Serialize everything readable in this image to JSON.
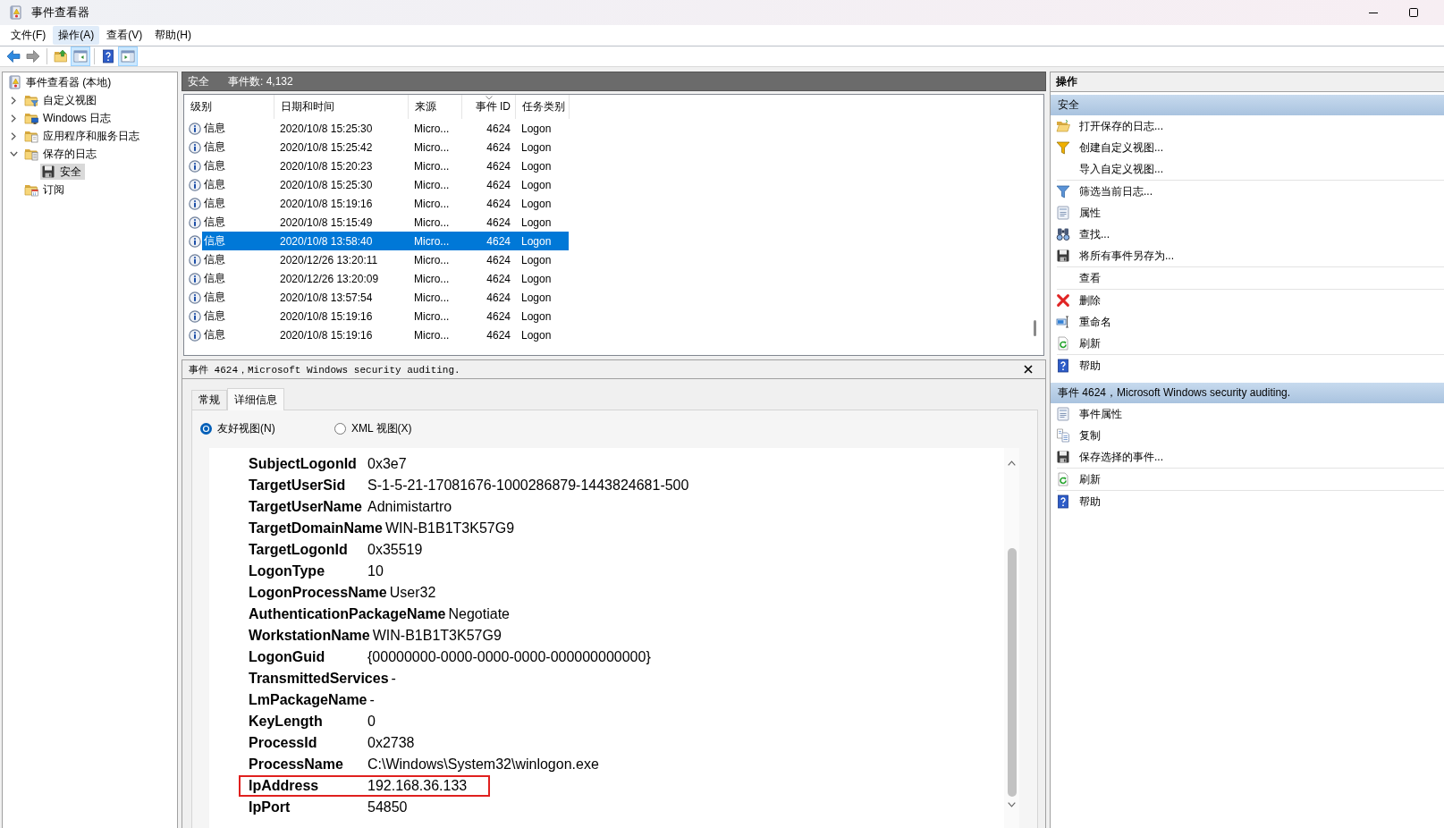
{
  "window": {
    "title": "事件查看器"
  },
  "menu": [
    {
      "label": "文件(F)",
      "highlighted": false
    },
    {
      "label": "操作(A)",
      "highlighted": true
    },
    {
      "label": "查看(V)",
      "highlighted": false
    },
    {
      "label": "帮助(H)",
      "highlighted": false
    }
  ],
  "toolbar": [
    [
      {
        "kind": "back",
        "pressed": false,
        "disabled": false
      },
      {
        "kind": "forward",
        "pressed": false,
        "disabled": true
      }
    ],
    [
      {
        "kind": "up",
        "pressed": false,
        "disabled": false
      },
      {
        "kind": "console-tree",
        "pressed": true,
        "disabled": false
      }
    ],
    [
      {
        "kind": "help",
        "pressed": false,
        "disabled": false
      },
      {
        "kind": "action-pane",
        "pressed": true,
        "disabled": false
      }
    ]
  ],
  "tree": [
    {
      "label": "事件查看器 (本地)",
      "kind": "console",
      "selected": false,
      "children": [
        {
          "label": "自定义视图",
          "kind": "custom-views",
          "expanded": false,
          "selected": false
        },
        {
          "label": "Windows 日志",
          "kind": "windows-logs",
          "expanded": false,
          "selected": false
        },
        {
          "label": "应用程序和服务日志",
          "kind": "app-logs",
          "expanded": false,
          "selected": false
        },
        {
          "label": "保存的日志",
          "kind": "saved-logs",
          "expanded": true,
          "selected": false,
          "children": [
            {
              "label": "安全",
              "kind": "log",
              "selected": true
            }
          ]
        },
        {
          "label": "订阅",
          "kind": "subscriptions",
          "selected": false
        }
      ]
    }
  ],
  "log_header": {
    "name": "安全",
    "count": "事件数: 4,132"
  },
  "events": {
    "columns": [
      {
        "label": "级别",
        "sorted": false
      },
      {
        "label": "日期和时间",
        "sorted": false
      },
      {
        "label": "来源",
        "sorted": false
      },
      {
        "label": "事件 ID",
        "sorted": true
      },
      {
        "label": "任务类别",
        "sorted": false
      }
    ],
    "rows": [
      {
        "level": "信息",
        "date": "2020/10/8 15:25:30",
        "source": "Micro...",
        "id": "4624",
        "task": "Logon",
        "selected": false
      },
      {
        "level": "信息",
        "date": "2020/10/8 15:25:42",
        "source": "Micro...",
        "id": "4624",
        "task": "Logon",
        "selected": false
      },
      {
        "level": "信息",
        "date": "2020/10/8 15:20:23",
        "source": "Micro...",
        "id": "4624",
        "task": "Logon",
        "selected": false
      },
      {
        "level": "信息",
        "date": "2020/10/8 15:25:30",
        "source": "Micro...",
        "id": "4624",
        "task": "Logon",
        "selected": false
      },
      {
        "level": "信息",
        "date": "2020/10/8 15:19:16",
        "source": "Micro...",
        "id": "4624",
        "task": "Logon",
        "selected": false
      },
      {
        "level": "信息",
        "date": "2020/10/8 15:15:49",
        "source": "Micro...",
        "id": "4624",
        "task": "Logon",
        "selected": false
      },
      {
        "level": "信息",
        "date": "2020/10/8 13:58:40",
        "source": "Micro...",
        "id": "4624",
        "task": "Logon",
        "selected": true
      },
      {
        "level": "信息",
        "date": "2020/12/26 13:20:11",
        "source": "Micro...",
        "id": "4624",
        "task": "Logon",
        "selected": false
      },
      {
        "level": "信息",
        "date": "2020/12/26 13:20:09",
        "source": "Micro...",
        "id": "4624",
        "task": "Logon",
        "selected": false
      },
      {
        "level": "信息",
        "date": "2020/10/8 13:57:54",
        "source": "Micro...",
        "id": "4624",
        "task": "Logon",
        "selected": false
      },
      {
        "level": "信息",
        "date": "2020/10/8 15:19:16",
        "source": "Micro...",
        "id": "4624",
        "task": "Logon",
        "selected": false
      },
      {
        "level": "信息",
        "date": "2020/10/8 15:19:16",
        "source": "Micro...",
        "id": "4624",
        "task": "Logon",
        "selected": false
      }
    ]
  },
  "event_detail": {
    "title": "事件 4624，Microsoft Windows security auditing.",
    "tabs": [
      {
        "label": "常规",
        "selected": false
      },
      {
        "label": "详细信息",
        "selected": true
      }
    ],
    "views": [
      {
        "label": "友好视图(N)",
        "selected": true
      },
      {
        "label": "XML 视图(X)",
        "selected": false
      }
    ],
    "fields": [
      {
        "name": "SubjectLogonId",
        "value": "0x3e7",
        "highlighted": false
      },
      {
        "name": "TargetUserSid",
        "value": "S-1-5-21-17081676-1000286879-1443824681-500",
        "highlighted": false
      },
      {
        "name": "TargetUserName",
        "value": "Adnimistartro",
        "highlighted": false
      },
      {
        "name": "TargetDomainName",
        "value": "WIN-B1B1T3K57G9",
        "highlighted": false
      },
      {
        "name": "TargetLogonId",
        "value": "0x35519",
        "highlighted": false
      },
      {
        "name": "LogonType",
        "value": "10",
        "highlighted": false
      },
      {
        "name": "LogonProcessName",
        "value": "User32",
        "highlighted": false
      },
      {
        "name": "AuthenticationPackageName",
        "value": "Negotiate",
        "highlighted": false
      },
      {
        "name": "WorkstationName",
        "value": "WIN-B1B1T3K57G9",
        "highlighted": false
      },
      {
        "name": "LogonGuid",
        "value": "{00000000-0000-0000-0000-000000000000}",
        "highlighted": false
      },
      {
        "name": "TransmittedServices",
        "value": "-",
        "highlighted": false
      },
      {
        "name": "LmPackageName",
        "value": "-",
        "highlighted": false
      },
      {
        "name": "KeyLength",
        "value": "0",
        "highlighted": false
      },
      {
        "name": "ProcessId",
        "value": "0x2738",
        "highlighted": false
      },
      {
        "name": "ProcessName",
        "value": "C:\\Windows\\System32\\winlogon.exe",
        "highlighted": false
      },
      {
        "name": "IpAddress",
        "value": "192.168.36.133",
        "highlighted": true
      },
      {
        "name": "IpPort",
        "value": "54850",
        "highlighted": false
      }
    ]
  },
  "actions": {
    "title": "操作",
    "sections": [
      {
        "title": "安全",
        "groups": [
          [
            {
              "label": "打开保存的日志...",
              "kind": "open"
            },
            {
              "label": "创建自定义视图...",
              "kind": "create-filter"
            },
            {
              "label": "导入自定义视图...",
              "kind": "none"
            }
          ],
          [
            {
              "label": "筛选当前日志...",
              "kind": "filter"
            },
            {
              "label": "属性",
              "kind": "properties"
            },
            {
              "label": "查找...",
              "kind": "find"
            },
            {
              "label": "将所有事件另存为...",
              "kind": "save"
            }
          ],
          [
            {
              "label": "查看",
              "kind": "none"
            }
          ],
          [
            {
              "label": "删除",
              "kind": "delete"
            },
            {
              "label": "重命名",
              "kind": "rename"
            },
            {
              "label": "刷新",
              "kind": "refresh"
            }
          ],
          [
            {
              "label": "帮助",
              "kind": "help"
            }
          ]
        ]
      },
      {
        "title": "事件 4624，Microsoft Windows security auditing.",
        "groups": [
          [
            {
              "label": "事件属性",
              "kind": "properties"
            },
            {
              "label": "复制",
              "kind": "copy"
            },
            {
              "label": "保存选择的事件...",
              "kind": "save"
            }
          ],
          [
            {
              "label": "刷新",
              "kind": "refresh"
            }
          ],
          [
            {
              "label": "帮助",
              "kind": "help"
            }
          ]
        ]
      }
    ]
  }
}
